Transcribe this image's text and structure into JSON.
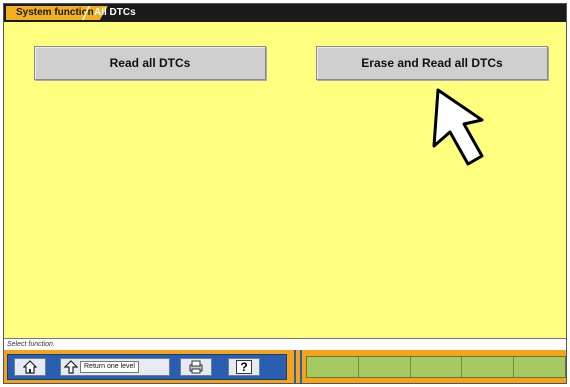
{
  "breadcrumb": {
    "items": [
      "System function",
      "All DTCs"
    ]
  },
  "buttons": {
    "read_all": "Read all DTCs",
    "erase_read_all": "Erase and Read all DTCs"
  },
  "status": {
    "text": "Select function."
  },
  "toolbar": {
    "home_icon": "home-icon",
    "return_label": "Return one level",
    "return_icon": "return-up-icon",
    "print_icon": "print-icon",
    "help_label": "?",
    "function_keys": [
      "",
      "",
      "",
      "",
      ""
    ]
  },
  "colors": {
    "background": "#ffff7f",
    "breadcrumb_active": "#f2b01e",
    "toolbar": "#f6a21a",
    "toolbar_blue": "#2a5fb0",
    "function_key_green": "#a6c962"
  }
}
